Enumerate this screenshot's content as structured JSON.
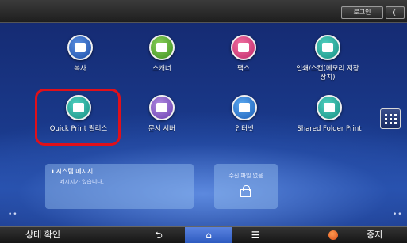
{
  "topbar": {
    "login_label": "로그인"
  },
  "apps": [
    {
      "label": "복사",
      "icon": "copy-icon"
    },
    {
      "label": "스캐너",
      "icon": "scanner-icon"
    },
    {
      "label": "팩스",
      "icon": "fax-icon"
    },
    {
      "label": "인쇄/스캔(메모리 저장",
      "label2": "장치)",
      "icon": "usb-memory-icon"
    },
    {
      "label": "Quick Print 릴리스",
      "icon": "quick-print-icon"
    },
    {
      "label": "문서 서버",
      "icon": "document-server-icon"
    },
    {
      "label": "인터넷",
      "icon": "globe-icon"
    },
    {
      "label": "Shared Folder Print",
      "icon": "shared-folder-print-icon"
    }
  ],
  "system_message": {
    "title": "시스템 메시지",
    "text": "메시지가 없습니다."
  },
  "received_files": {
    "text": "수신 파일 없음"
  },
  "bottombar": {
    "status_label": "상태 확인",
    "stop_label": "중지"
  },
  "colors": {
    "highlight": "#e0101a",
    "home_active": "#3a68d0"
  }
}
